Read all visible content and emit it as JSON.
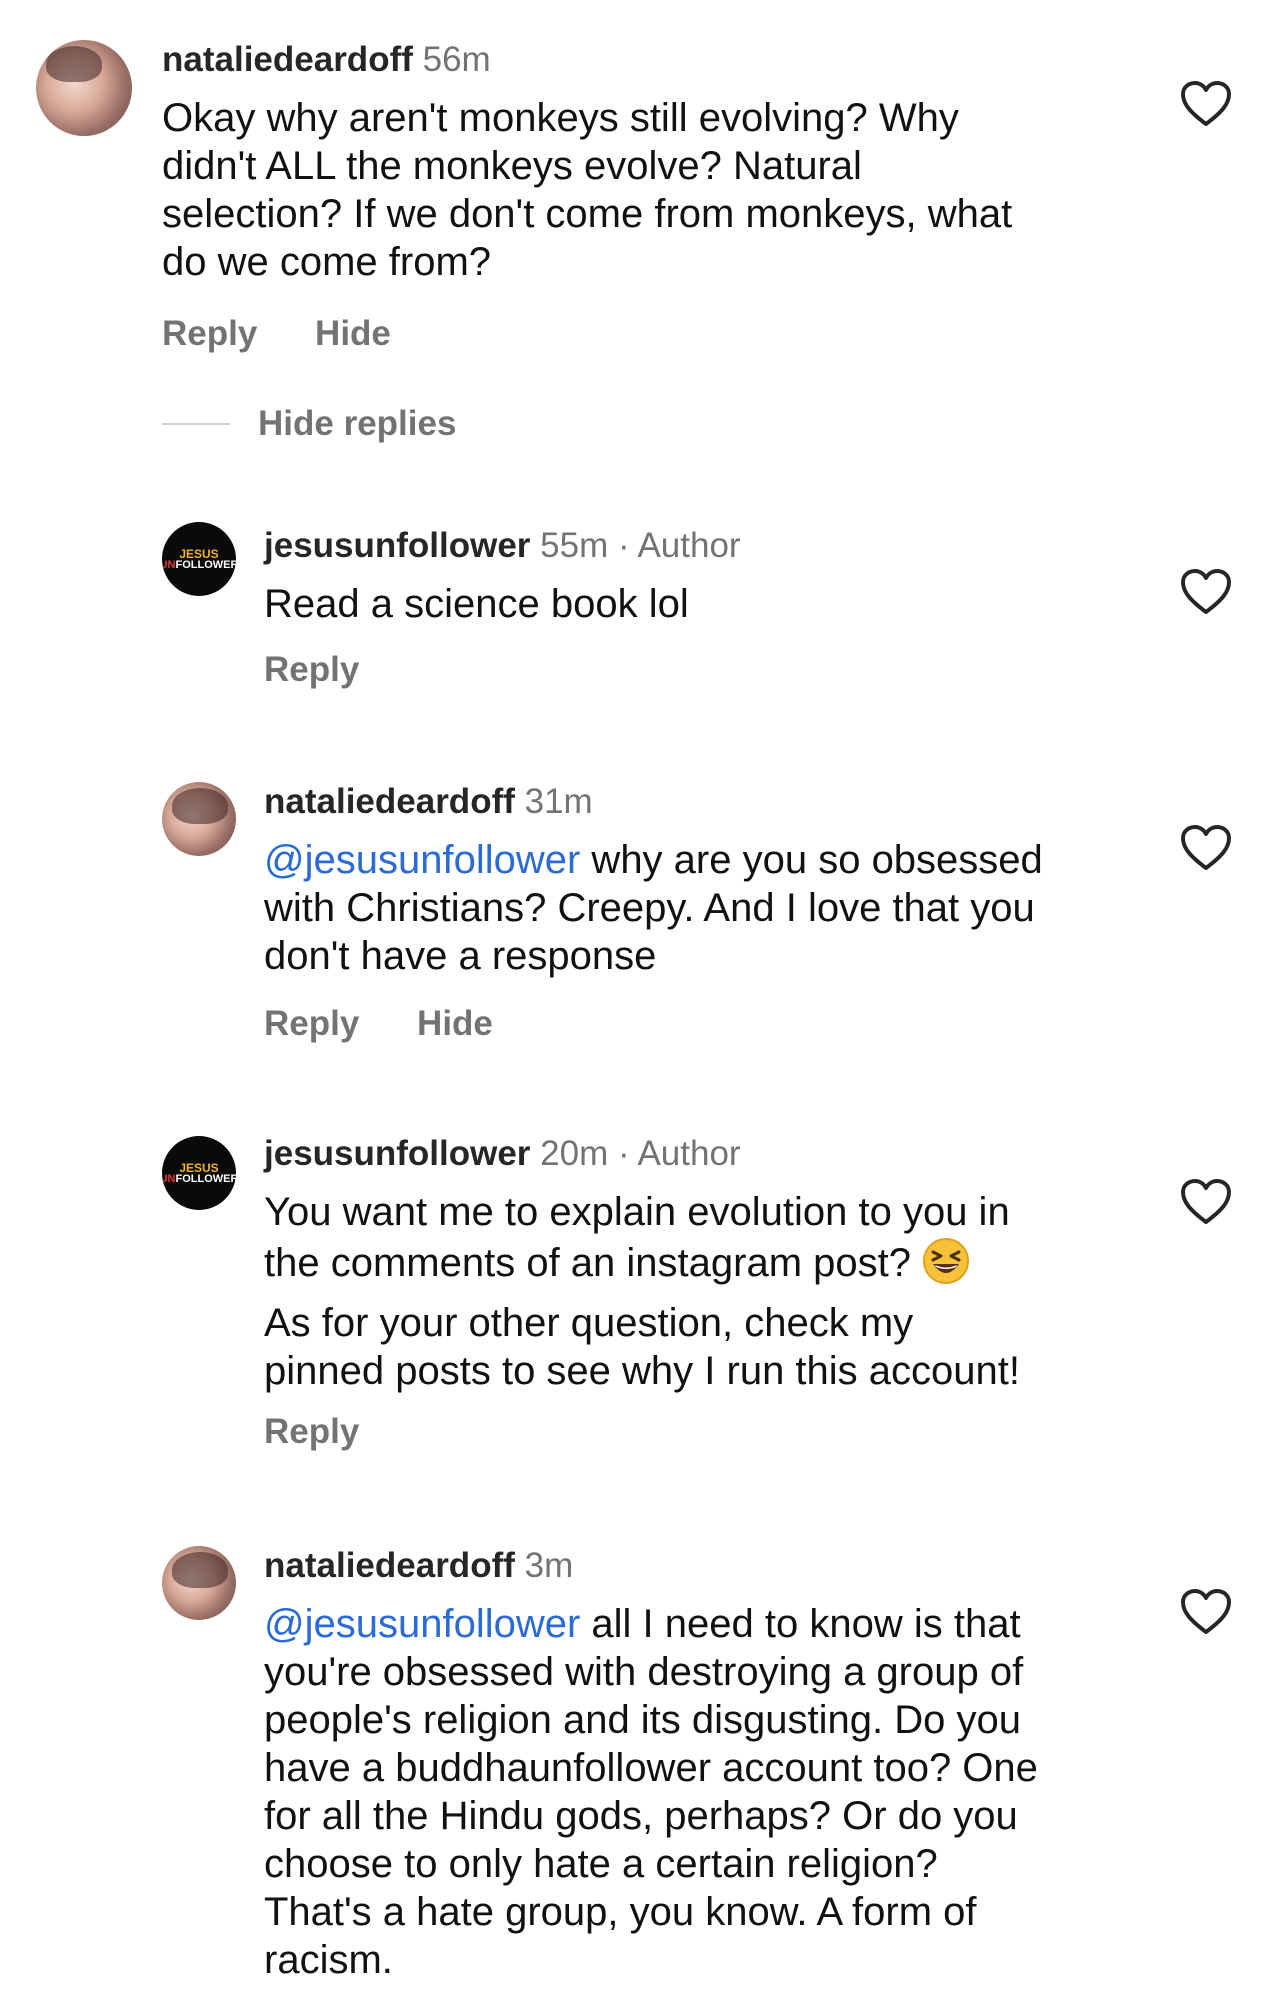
{
  "comments": [
    {
      "username": "nataliedeardoff",
      "time": "56m",
      "author_badge": "",
      "lines": [
        "Okay why aren't monkeys still evolving? Why",
        "didn't ALL the monkeys evolve? Natural",
        "selection? If we don't come from monkeys, what",
        "do we come from?"
      ],
      "actions": [
        "Reply",
        "Hide"
      ]
    },
    {
      "username": "jesusunfollower",
      "time": "55m",
      "author_badge": "· Author",
      "lines": [
        "Read a science book lol"
      ],
      "actions": [
        "Reply"
      ]
    },
    {
      "username": "nataliedeardoff",
      "time": "31m",
      "author_badge": "",
      "mention": "@jesusunfollower",
      "lines": [
        " why are you so obsessed",
        "with Christians? Creepy. And I love that you",
        "don't have a response"
      ],
      "actions": [
        "Reply",
        "Hide"
      ]
    },
    {
      "username": "jesusunfollower",
      "time": "20m",
      "author_badge": "· Author",
      "lines": [
        "You want me to explain evolution to you in",
        "the comments of an instagram post?",
        "As for your other question, check my",
        "pinned posts to see why I run this account!"
      ],
      "emoji": "grinning-squinting-face",
      "actions": [
        "Reply"
      ]
    },
    {
      "username": "nataliedeardoff",
      "time": "3m",
      "author_badge": "",
      "mention": "@jesusunfollower",
      "lines": [
        " all I need to know is that",
        "you're obsessed with destroying a group of",
        "people's religion and its disgusting. Do you",
        "have a buddhaunfollower account too? One",
        "for all the Hindu gods, perhaps? Or do you",
        "choose to only hate a certain religion?",
        "That's a hate group, you know. A form of",
        "racism."
      ],
      "actions": []
    }
  ],
  "hide_replies_label": "Hide replies",
  "brand_avatar": {
    "line1": "JESUS",
    "line2_prefix": "UN",
    "line2_rest": "FOLLOWER"
  },
  "icons": {
    "like": "heart-outline-icon"
  },
  "colors": {
    "mention": "#2a6bd8",
    "secondary_text": "#737373"
  }
}
